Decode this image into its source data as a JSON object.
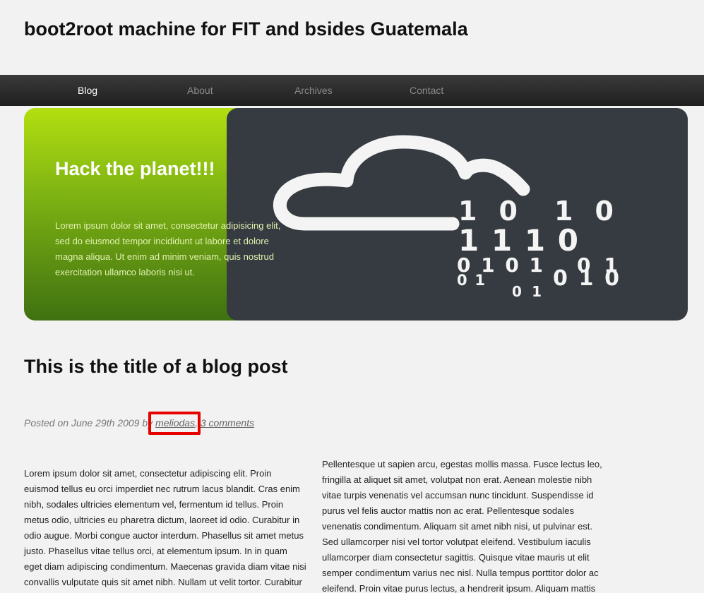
{
  "site": {
    "title": "boot2root machine for FIT and bsides Guatemala"
  },
  "nav": {
    "items": [
      {
        "label": "Blog",
        "active": true
      },
      {
        "label": "About",
        "active": false
      },
      {
        "label": "Archives",
        "active": false
      },
      {
        "label": "Contact",
        "active": false
      }
    ]
  },
  "hero": {
    "heading": "Hack the planet!!!",
    "text": "Lorem ipsum dolor sit amet, consectetur adipisicing elit, sed do eiusmod tempor incididunt ut labore et dolore magna aliqua. Ut enim ad minim veniam, quis nostrud exercitation ullamco laboris nisi ut.",
    "image_icon": "cloud-binary-icon",
    "image_digits": [
      "10",
      "10",
      "1110",
      "0101",
      "01",
      "01",
      "010",
      "01"
    ]
  },
  "post": {
    "title": "This is the title of a blog post",
    "meta_prefix": "Posted on June 29th 2009 by",
    "author": "meliodas",
    "meta_separator": ",",
    "comments": "3 comments",
    "col_left": "Lorem ipsum dolor sit amet, consectetur adipiscing elit. Proin euismod tellus eu orci imperdiet nec rutrum lacus blandit. Cras enim nibh, sodales ultricies elementum vel, fermentum id tellus. Proin metus odio, ultricies eu pharetra dictum, laoreet id odio. Curabitur in odio augue. Morbi congue auctor interdum. Phasellus sit amet metus justo. Phasellus vitae tellus orci, at elementum ipsum. In in quam eget diam adipiscing condimentum. Maecenas gravida diam vitae nisi convallis vulputate quis sit amet nibh. Nullam ut velit tortor. Curabitur",
    "col_right": "Pellentesque ut sapien arcu, egestas mollis massa. Fusce lectus leo, fringilla at aliquet sit amet, volutpat non erat. Aenean molestie nibh vitae turpis venenatis vel accumsan nunc tincidunt. Suspendisse id purus vel felis auctor mattis non ac erat. Pellentesque sodales venenatis condimentum. Aliquam sit amet nibh nisi, ut pulvinar est. Sed ullamcorper nisi vel tortor volutpat eleifend. Vestibulum iaculis ullamcorper diam consectetur sagittis. Quisque vitae mauris ut elit semper condimentum varius nec nisl. Nulla tempus porttitor dolor ac eleifend. Proin vitae purus lectus, a hendrerit ipsum. Aliquam mattis"
  },
  "colors": {
    "nav_bg": "#2a2a2a",
    "hero_green_top": "#b3df10",
    "hero_green_bottom": "#3f7111",
    "hero_image_bg": "#353b40",
    "highlight": "#e60000"
  }
}
